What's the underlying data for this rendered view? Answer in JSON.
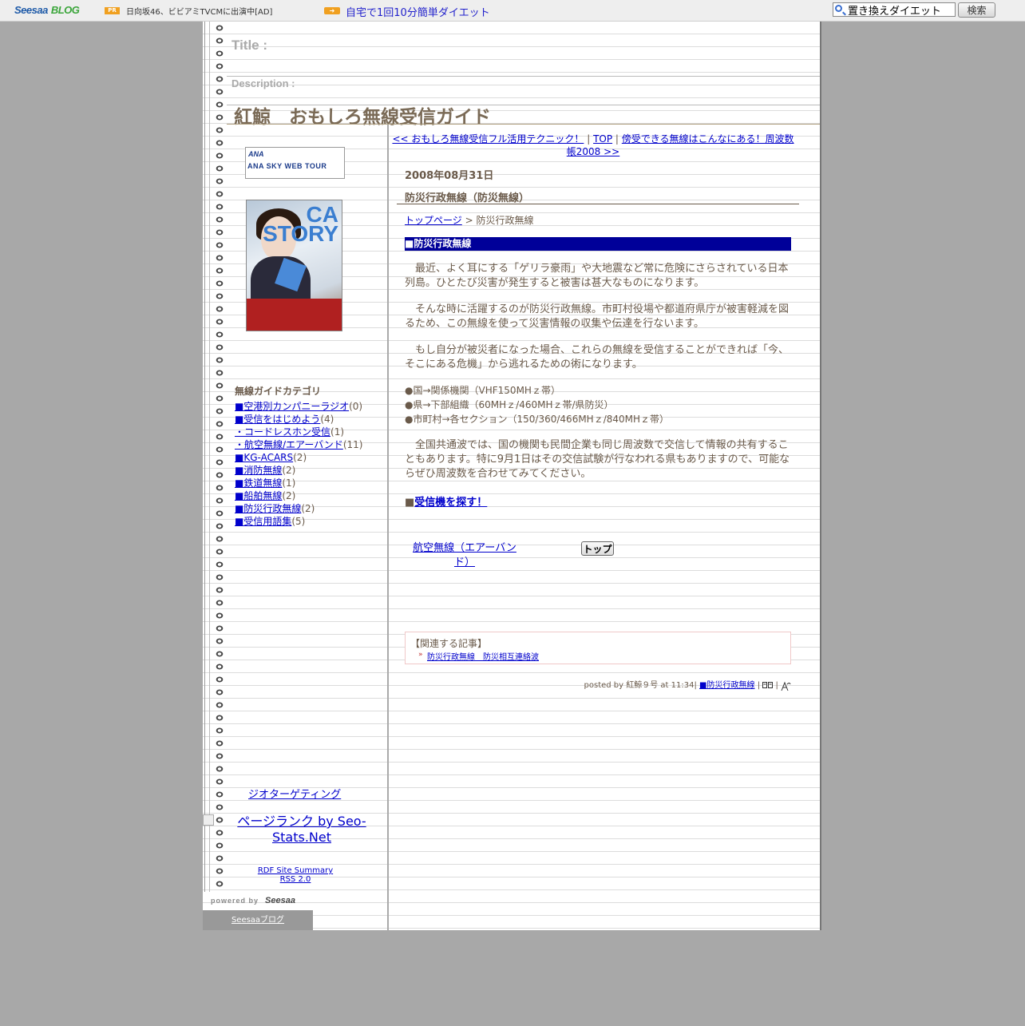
{
  "topbar": {
    "logo_main": "Seesaa",
    "logo_sub": "BLOG",
    "pr_badge": "PR",
    "ad1": "日向坂46、ビビアミTVCMに出演中[AD]",
    "ad2": "自宅で1回10分簡単ダイエット",
    "search_value": "置き換えダイエット",
    "search_button": "検索"
  },
  "header": {
    "title_label": "Title :",
    "description_label": "Description :",
    "blog_title": "紅鯨　おもしろ無線受信ガイド"
  },
  "sidebar": {
    "ana_logo": "ANA",
    "ana_text": "ANA SKY WEB TOUR",
    "book_title": "CA STORY",
    "category_heading": "無線ガイドカテゴリ",
    "categories": [
      {
        "label": "■空港別カンパニーラジオ",
        "count": "(0)"
      },
      {
        "label": "■受信をはじめよう",
        "count": "(4)"
      },
      {
        "label": "・コードレスホン受信",
        "count": "(1)"
      },
      {
        "label": "・航空無線/エアーバンド",
        "count": "(11)"
      },
      {
        "label": "■KG-ACARS",
        "count": "(2)"
      },
      {
        "label": "■消防無線",
        "count": "(2)"
      },
      {
        "label": "■鉄道無線",
        "count": "(1)"
      },
      {
        "label": "■船舶無線",
        "count": "(2)"
      },
      {
        "label": "■防災行政無線",
        "count": "(2)"
      },
      {
        "label": "■受信用語集",
        "count": "(5)"
      }
    ],
    "geo_link": "ジオターゲティング",
    "pagerank_link": "ページランク by Seo-Stats.Net",
    "rdf_link": "RDF Site Summary",
    "rss_link": "RSS 2.0",
    "powered_by": "powered by",
    "powered_logo": "Seesaa",
    "seesaa_blog_link": "Seesaaブログ"
  },
  "nav": {
    "prev": "<< おもしろ無線受信フル活用テクニック！",
    "separator": "|",
    "top": "TOP",
    "next": "傍受できる無線はこんなにある！周波数帳2008 >>"
  },
  "post": {
    "date": "2008年08月31日",
    "title": "防災行政無線（防災無線）",
    "breadcrumb_home": "トップページ",
    "breadcrumb_rest": " > 防災行政無線",
    "section_heading": "■防災行政無線",
    "para1": "　最近、よく耳にする「ゲリラ豪雨」や大地震など常に危険にさらされている日本列島。ひとたび災害が発生すると被害は甚大なものになります。",
    "para2": "　そんな時に活躍するのが防災行政無線。市町村役場や都道府県庁が被害軽減を図るため、この無線を使って災害情報の収集や伝達を行ないます。",
    "para3": "　もし自分が被災者になった場合、これらの無線を受信することができれば「今、そこにある危機」から逃れるための術になります。",
    "bullets": [
      "●国→関係機関（VHF150MHｚ帯）",
      "●県→下部組織（60MHｚ/460MHｚ帯/県防災）",
      "●市町村→各セクション（150/360/466MHｚ/840MHｚ帯）"
    ],
    "para4": "　全国共通波では、国の機関も民間企業も同じ周波数で交信して情報の共有することもあります。特に9月1日はその交信試験が行なわれる県もありますので、可能ならぜひ周波数を合わせてみてください。",
    "find_prefix": "■",
    "find_link": "受信機を探す！",
    "prev_post_link": "航空無線（エアーバンド）",
    "top_button": "トップ",
    "related_heading": "【関連する記事】",
    "related_link": "防災行政無線　防災相互連絡波",
    "posted_by": "posted by 紅鯨９号 at 11:34|",
    "posted_category": "■防災行政無線",
    "posted_sep1": "|",
    "posted_sep2": "|"
  },
  "colors": {
    "text": "#6a5a4a",
    "link": "#0000cc",
    "section_bar": "#000099",
    "background": "#a8a8a8"
  }
}
